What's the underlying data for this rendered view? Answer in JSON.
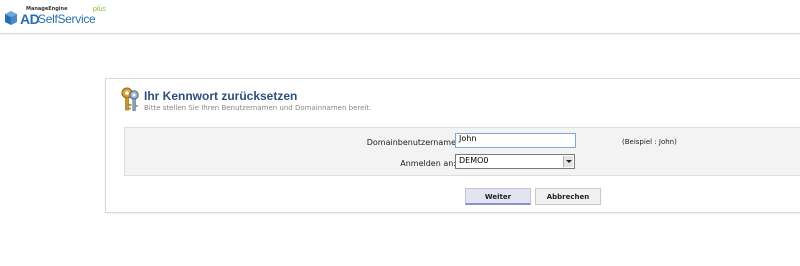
{
  "header": {
    "logo": {
      "manageengine": "ManageEngine",
      "ad": "AD",
      "selfservice": "SelfService",
      "plus": "plus"
    }
  },
  "form": {
    "title": "Ihr Kennwort zurücksetzen",
    "subtitle": "Bitte stellen Sie Ihren Benutzernamen und Domainnamen bereit.",
    "username_label": "Domainbenutzername",
    "username_value": "John",
    "username_example": "(Beispiel : John)",
    "domain_label": "Anmelden an:",
    "domain_value": "DEMO0"
  },
  "buttons": {
    "next_label": "Weiter",
    "cancel_label": "Abbrechen"
  },
  "colors": {
    "brand": "#2a6db0",
    "title": "#2e4f7f",
    "plus": "#8bbf2d",
    "next_button_accent": "#8f8fd0"
  }
}
